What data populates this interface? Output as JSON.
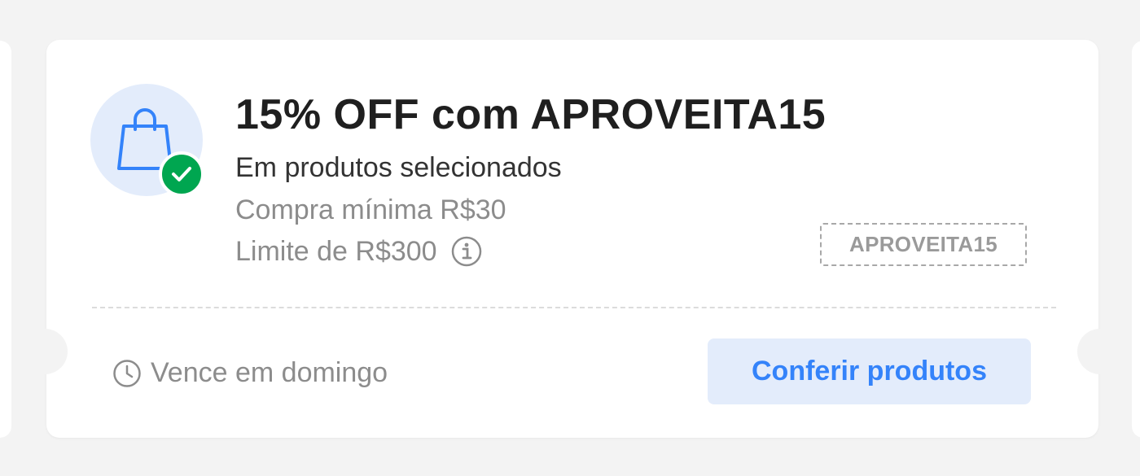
{
  "coupon": {
    "title": "15% OFF com APROVEITA15",
    "subtitle": "Em produtos selecionados",
    "min_purchase": "Compra mínima R$30",
    "limit": "Limite de R$300",
    "code": "APROVEITA15",
    "expiry": "Vence em domingo",
    "cta_label": "Conferir produtos"
  },
  "icons": {
    "main": "shopping-bag-icon",
    "badge": "check-icon",
    "info": "info-icon",
    "clock": "clock-icon"
  },
  "colors": {
    "page_background": "#f3f3f3",
    "card_background": "#ffffff",
    "icon_circle": "#e3ecfb",
    "bag_stroke": "#3483fa",
    "check_badge": "#00a650",
    "cta_background": "#e3ecfb",
    "cta_text": "#3483fa",
    "title_text": "#1f1f1f",
    "muted_text": "#8c8c8c"
  }
}
